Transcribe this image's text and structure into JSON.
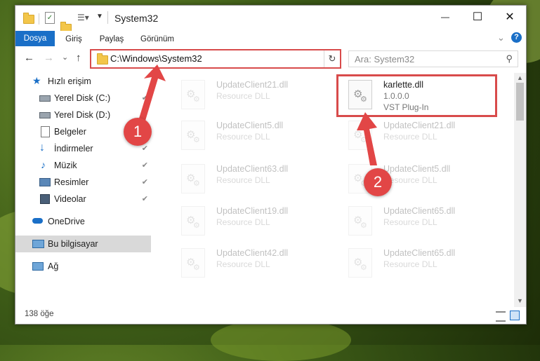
{
  "window": {
    "title": "System32",
    "controls": {
      "minimize": "—",
      "maximize": "☐",
      "close": "✕"
    }
  },
  "ribbon": {
    "tabs": [
      "Dosya",
      "Giriş",
      "Paylaş",
      "Görünüm"
    ],
    "help_icon": "?",
    "expand_icon": "⌄"
  },
  "address_bar": {
    "path": "C:\\Windows\\System32",
    "refresh_icon": "↻"
  },
  "search": {
    "placeholder": "Ara: System32",
    "icon": "⚲"
  },
  "nav_buttons": {
    "back": "←",
    "forward": "→",
    "recent": "⌄",
    "up": "↑"
  },
  "sidebar": {
    "items": [
      {
        "label": "Hızlı erişim",
        "icon": "star-icon"
      },
      {
        "label": "Yerel Disk (C:)",
        "icon": "drive-icon",
        "pinned": true
      },
      {
        "label": "Yerel Disk (D:)",
        "icon": "drive-icon",
        "pinned": true
      },
      {
        "label": "Belgeler",
        "icon": "documents-icon",
        "pinned": true
      },
      {
        "label": "İndirmeler",
        "icon": "download-icon",
        "pinned": true
      },
      {
        "label": "Müzik",
        "icon": "music-icon",
        "pinned": true
      },
      {
        "label": "Resimler",
        "icon": "pictures-icon",
        "pinned": true
      },
      {
        "label": "Videolar",
        "icon": "videos-icon",
        "pinned": true
      },
      {
        "label": "OneDrive",
        "icon": "cloud-icon"
      },
      {
        "label": "Bu bilgisayar",
        "icon": "computer-icon",
        "selected": true
      },
      {
        "label": "Ağ",
        "icon": "network-icon"
      }
    ],
    "pin_icon": "📌"
  },
  "files": {
    "highlighted": {
      "name": "karlette.dll",
      "version": "1.0.0.0",
      "type": "VST Plug-In"
    },
    "left_column": [
      {
        "name": "UpdateClient21.dll",
        "type": "Resource DLL"
      },
      {
        "name": "UpdateClient5.dll",
        "type": "Resource DLL"
      },
      {
        "name": "UpdateClient63.dll",
        "type": "Resource DLL"
      },
      {
        "name": "UpdateClient19.dll",
        "type": "Resource DLL"
      },
      {
        "name": "UpdateClient42.dll",
        "type": "Resource DLL"
      }
    ],
    "right_column": [
      {
        "name": "UpdateClient21.dll",
        "type": "Resource DLL"
      },
      {
        "name": "UpdateClient5.dll",
        "type": "Resource DLL"
      },
      {
        "name": "UpdateClient65.dll",
        "type": "Resource DLL"
      },
      {
        "name": "UpdateClient65.dll",
        "type": "Resource DLL"
      }
    ]
  },
  "status_bar": {
    "item_count": "138 öğe"
  },
  "annotations": {
    "step1": "1",
    "step2": "2"
  },
  "colors": {
    "accent": "#1a6fc7",
    "highlight": "#d84b4b",
    "badge": "#e24646"
  }
}
